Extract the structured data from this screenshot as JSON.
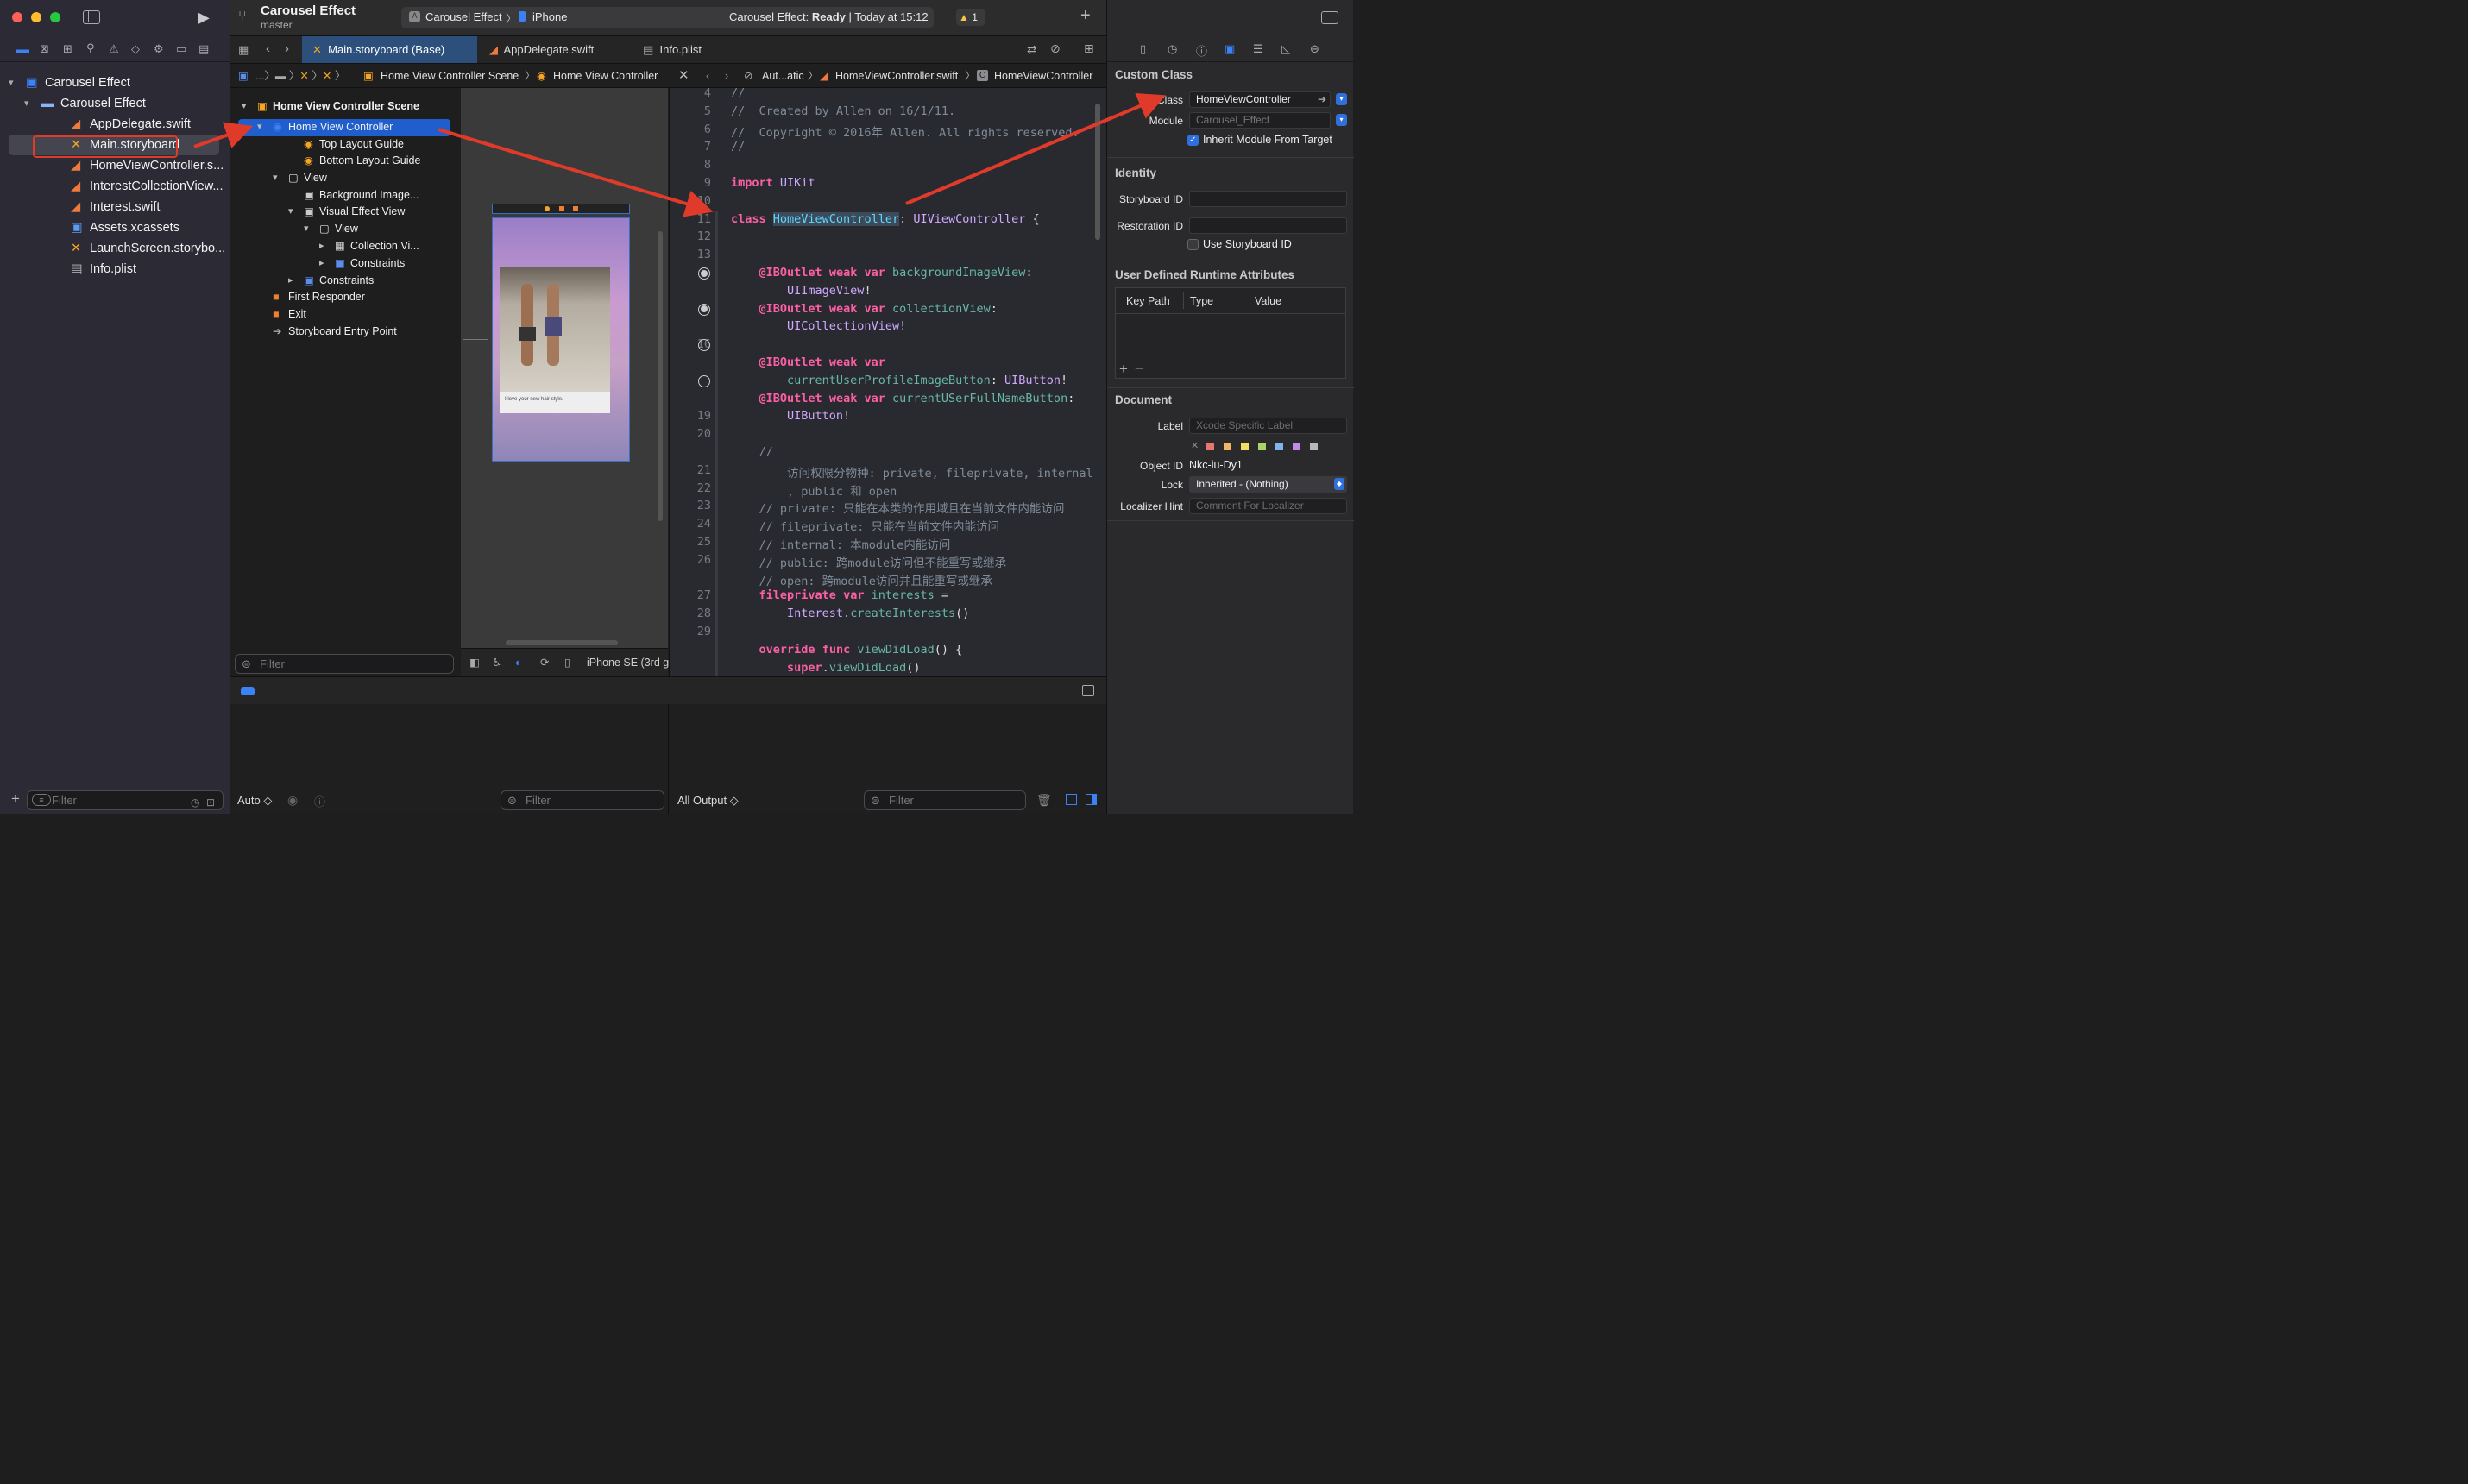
{
  "window": {
    "project_title": "Carousel Effect",
    "branch": "master",
    "scheme": "Carousel Effect",
    "device": "iPhone",
    "status_prefix": "Carousel Effect:",
    "status_state": "Ready",
    "status_time": "| Today at 15:12",
    "warnings": "1"
  },
  "navigator": {
    "items": [
      {
        "label": "Carousel Effect",
        "kind": "project"
      },
      {
        "label": "Carousel Effect",
        "kind": "folder"
      },
      {
        "label": "AppDelegate.swift",
        "kind": "swift"
      },
      {
        "label": "Main.storyboard",
        "kind": "storyboard"
      },
      {
        "label": "HomeViewController.s...",
        "kind": "swift"
      },
      {
        "label": "InterestCollectionView...",
        "kind": "swift"
      },
      {
        "label": "Interest.swift",
        "kind": "swift"
      },
      {
        "label": "Assets.xcassets",
        "kind": "assets"
      },
      {
        "label": "LaunchScreen.storybo...",
        "kind": "storyboard"
      },
      {
        "label": "Info.plist",
        "kind": "plist"
      }
    ],
    "filter_placeholder": "Filter"
  },
  "tabs": [
    {
      "label": "Main.storyboard (Base)"
    },
    {
      "label": "AppDelegate.swift"
    },
    {
      "label": "Info.plist"
    }
  ],
  "jumpbar": {
    "left_scene": "Home View Controller Scene",
    "left_vc": "Home View Controller",
    "right_auto": "Aut...atic",
    "right_file": "HomeViewController.swift",
    "right_class": "HomeViewController"
  },
  "outline": {
    "items": [
      {
        "label": "Home View Controller Scene"
      },
      {
        "label": "Home View Controller"
      },
      {
        "label": "Top Layout Guide"
      },
      {
        "label": "Bottom Layout Guide"
      },
      {
        "label": "View"
      },
      {
        "label": "Background Image..."
      },
      {
        "label": "Visual Effect View"
      },
      {
        "label": "View"
      },
      {
        "label": "Collection Vi..."
      },
      {
        "label": "Constraints"
      },
      {
        "label": "Constraints"
      },
      {
        "label": "First Responder"
      },
      {
        "label": "Exit"
      },
      {
        "label": "Storyboard Entry Point"
      }
    ],
    "filter_placeholder": "Filter"
  },
  "canvas": {
    "caption": "I love your new hair style.",
    "device_label": "iPhone SE (3rd g"
  },
  "code": {
    "line_numbers": [
      "4",
      "5",
      "6",
      "7",
      "8",
      "9",
      "10",
      "11",
      "12",
      "13",
      "",
      "",
      "",
      "",
      "16",
      "",
      "",
      "",
      "19",
      "20",
      "",
      "21",
      "22",
      "23",
      "24",
      "25",
      "26",
      "",
      "27",
      "28",
      "29"
    ],
    "lines": [
      "//",
      "//  Created by Allen on 16/1/11.",
      "//  Copyright © 2016年 Allen. All rights reserved.",
      "//",
      "",
      "import UIKit",
      "",
      "class HomeViewController: UIViewController {",
      "",
      "",
      "    @IBOutlet weak var backgroundImageView:",
      "        UIImageView!",
      "    @IBOutlet weak var collectionView:",
      "        UICollectionView!",
      "",
      "    @IBOutlet weak var",
      "        currentUserProfileImageButton: UIButton!",
      "    @IBOutlet weak var currentUSerFullNameButton:",
      "        UIButton!",
      "",
      "    //",
      "        访问权限分物种: private, fileprivate, internal",
      "        , public 和 open",
      "    // private: 只能在本类的作用域且在当前文件内能访问",
      "    // fileprivate: 只能在当前文件内能访问",
      "    // internal: 本module内能访问",
      "    // public: 跨module访问但不能重写或继承",
      "    // open: 跨module访问并且能重写或继承",
      "    fileprivate var interests =",
      "        Interest.createInterests()",
      "",
      "    override func viewDidLoad() {",
      "        super.viewDidLoad()"
    ]
  },
  "debug": {
    "auto_label": "Auto ◇",
    "filter_left": "Filter",
    "output_label": "All Output ◇",
    "filter_right": "Filter"
  },
  "inspector": {
    "custom_class_title": "Custom Class",
    "class_label": "Class",
    "class_value": "HomeViewController",
    "module_label": "Module",
    "module_value": "Carousel_Effect",
    "inherit_label": "Inherit Module From Target",
    "identity_title": "Identity",
    "storyboard_id_label": "Storyboard ID",
    "restoration_id_label": "Restoration ID",
    "use_sb_id_label": "Use Storyboard ID",
    "udra_title": "User Defined Runtime Attributes",
    "col_key": "Key Path",
    "col_type": "Type",
    "col_value": "Value",
    "document_title": "Document",
    "label_label": "Label",
    "label_placeholder": "Xcode Specific Label",
    "object_id_label": "Object ID",
    "object_id_value": "Nkc-iu-Dy1",
    "lock_label": "Lock",
    "lock_value": "Inherited - (Nothing)",
    "localizer_label": "Localizer Hint",
    "localizer_placeholder": "Comment For Localizer",
    "swatch_colors": [
      "#e8766e",
      "#f0b566",
      "#f2dc62",
      "#a8d46a",
      "#7cb4f0",
      "#c48ae6",
      "#b8b8b8"
    ]
  },
  "colors": {
    "accent": "#2b62d9",
    "annotation": "#e03a2a",
    "selection": "#1f5ecc"
  }
}
